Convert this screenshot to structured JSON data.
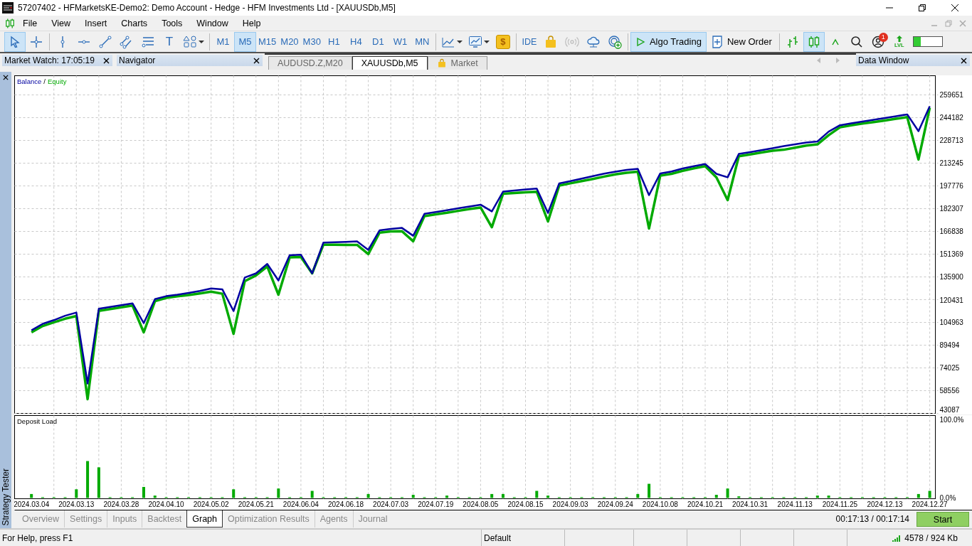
{
  "window": {
    "title": "57207402 - HFMarketsKE-Demo2: Demo Account - Hedge - HFM Investments Ltd - [XAUUSDb,M5]"
  },
  "menu": [
    "File",
    "View",
    "Insert",
    "Charts",
    "Tools",
    "Window",
    "Help"
  ],
  "toolbar": {
    "tools": [
      {
        "kind": "cursor",
        "selected": true
      },
      {
        "kind": "crosshair",
        "selected": false
      },
      {
        "kind": "vline",
        "selected": false
      },
      {
        "kind": "hline",
        "selected": false
      },
      {
        "kind": "trendline",
        "selected": false
      },
      {
        "kind": "channel",
        "selected": false
      },
      {
        "kind": "fibo",
        "selected": false
      },
      {
        "kind": "text",
        "label": "T",
        "selected": false
      },
      {
        "kind": "shapes",
        "selected": false
      }
    ],
    "timeframes": [
      {
        "label": "M1",
        "selected": false
      },
      {
        "label": "M5",
        "selected": true
      },
      {
        "label": "M15",
        "selected": false
      },
      {
        "label": "M20",
        "selected": false
      },
      {
        "label": "M30",
        "selected": false
      },
      {
        "label": "H1",
        "selected": false
      },
      {
        "label": "H4",
        "selected": false
      },
      {
        "label": "D1",
        "selected": false
      },
      {
        "label": "W1",
        "selected": false
      },
      {
        "label": "MN",
        "selected": false
      }
    ],
    "charts": [
      {
        "kind": "line-chart"
      },
      {
        "kind": "template"
      },
      {
        "kind": "dollar",
        "label": "$"
      }
    ],
    "services": [
      {
        "kind": "ide",
        "label": "IDE",
        "disabled": false
      },
      {
        "kind": "bag",
        "disabled": false
      },
      {
        "kind": "signals",
        "disabled": true
      },
      {
        "kind": "cloud",
        "disabled": false
      },
      {
        "kind": "vps",
        "disabled": false
      }
    ],
    "algo_trading": {
      "label": "Algo Trading",
      "on": true
    },
    "new_order": {
      "label": "New Order"
    },
    "chart_types": [
      {
        "kind": "bars",
        "selected": false
      },
      {
        "kind": "candles",
        "selected": true
      },
      {
        "kind": "line",
        "selected": false
      }
    ],
    "account_badge": "1",
    "level_label": "LVL",
    "meter": {
      "level": 0.25
    }
  },
  "panels": [
    {
      "title": "Market Watch: 17:05:19"
    },
    {
      "title": "Navigator"
    }
  ],
  "chart_tabs": [
    {
      "label": "AUDUSD.Z,M20",
      "kind": "chart",
      "selected": false
    },
    {
      "label": "XAUUSDb,M5",
      "kind": "chart",
      "selected": true
    },
    {
      "label": "Market",
      "kind": "market",
      "selected": false
    }
  ],
  "data_window": {
    "title": "Data Window"
  },
  "tester": {
    "title": "Strategy Tester",
    "balance_chart": {
      "legend_separator": "/",
      "chart_data": {
        "type": "line",
        "grid": true,
        "ylim": [
          43087,
          272702
        ],
        "yticks": [
          43087,
          58556,
          74025,
          89494,
          104963,
          120431,
          135900,
          151369,
          166838,
          182307,
          197776,
          213245,
          228713,
          244182,
          259651
        ],
        "categories": [
          null,
          null,
          null,
          null,
          null,
          null,
          null,
          null,
          null,
          null,
          null,
          null,
          null,
          null,
          null,
          null,
          null,
          null,
          null,
          null,
          null,
          null,
          null,
          null,
          null,
          null,
          null,
          null,
          null,
          null,
          null,
          null,
          null,
          null,
          null,
          null,
          null,
          null,
          null,
          null,
          null,
          null,
          null,
          null,
          null,
          null,
          null,
          null,
          null,
          null,
          null,
          null,
          null,
          null,
          null,
          null,
          null,
          null,
          null,
          null,
          null,
          null,
          null,
          null,
          null,
          null,
          null,
          null,
          null,
          null,
          null,
          null,
          null,
          null,
          null,
          null,
          null,
          null,
          null,
          null,
          null,
          null
        ],
        "series": [
          {
            "name": "Balance",
            "color": "#0000a0",
            "values": [
              null,
              99600,
              104000,
              106500,
              109500,
              111700,
              63400,
              114300,
              115500,
              116700,
              117900,
              104500,
              120800,
              122800,
              123800,
              125000,
              126400,
              128000,
              127500,
              112700,
              135500,
              138300,
              144700,
              133500,
              150600,
              151000,
              138300,
              159200,
              159500,
              159700,
              160000,
              154300,
              167500,
              168500,
              169200,
              163900,
              178800,
              180000,
              181200,
              182500,
              183700,
              185000,
              180400,
              193900,
              194600,
              195300,
              196000,
              179400,
              199500,
              201000,
              202700,
              204400,
              206100,
              207500,
              208700,
              209400,
              191500,
              206300,
              207600,
              209600,
              211200,
              212600,
              206000,
              203600,
              219500,
              220800,
              222100,
              223400,
              224800,
              226000,
              227200,
              228000,
              234700,
              239000,
              240300,
              241500,
              242800,
              244000,
              245200,
              246400,
              235000,
              251900
            ]
          },
          {
            "name": "Equity",
            "color": "#00aa00",
            "values": [
              null,
              98200,
              102500,
              105000,
              107500,
              109300,
              52800,
              112800,
              114000,
              115200,
              116400,
              98200,
              119400,
              121600,
              122700,
              123600,
              124700,
              125900,
              124500,
              97200,
              133000,
              136900,
              143000,
              123800,
              149200,
              149400,
              138300,
              157800,
              157800,
              157700,
              157700,
              151400,
              166000,
              166800,
              167000,
              160100,
              177300,
              178400,
              179500,
              180800,
              182000,
              183100,
              169700,
              192500,
              193000,
              193400,
              193800,
              173600,
              198000,
              199500,
              201000,
              202500,
              204100,
              205600,
              206700,
              207400,
              168800,
              204800,
              206000,
              208000,
              209700,
              211200,
              203600,
              188100,
              218000,
              219200,
              220500,
              221700,
              222400,
              223800,
              225200,
              226000,
              232300,
              237600,
              239000,
              240200,
              241200,
              242300,
              243400,
              244500,
              215700,
              250900
            ]
          }
        ]
      }
    },
    "deposit_chart": {
      "chart_data": {
        "type": "bar",
        "grid": true,
        "ylim": [
          -1,
          105
        ],
        "yticks": [
          {
            "value": 0,
            "label": "0.0%"
          },
          {
            "value": 100,
            "label": "100.0%"
          }
        ],
        "categories": [
          null,
          "2024.03.04",
          null,
          null,
          null,
          "2024.03.13",
          null,
          null,
          null,
          "2024.03.28",
          null,
          null,
          null,
          "2024.04.10",
          null,
          null,
          null,
          "2024.05.02",
          null,
          null,
          null,
          "2024.05.21",
          null,
          null,
          null,
          "2024.06.04",
          null,
          null,
          null,
          "2024.06.18",
          null,
          null,
          null,
          "2024.07.03",
          null,
          null,
          null,
          "2024.07.19",
          null,
          null,
          null,
          "2024.08.05",
          null,
          null,
          null,
          "2024.08.15",
          null,
          null,
          null,
          "2024.09.03",
          null,
          null,
          null,
          "2024.09.24",
          null,
          null,
          null,
          "2024.10.08",
          null,
          null,
          null,
          "2024.10.21",
          null,
          null,
          null,
          "2024.10.31",
          null,
          null,
          null,
          "2024.11.13",
          null,
          null,
          null,
          "2024.11.25",
          null,
          null,
          null,
          "2024.12.13",
          null,
          null,
          null,
          "2024.12.27"
        ],
        "series": [
          {
            "name": "Deposit Load",
            "color": "#00aa00",
            "values": [
              null,
              5,
              1,
              1,
              1,
              11,
              47,
              39,
              1,
              1,
              1,
              14,
              3,
              1,
              1,
              1,
              1,
              1,
              1,
              11,
              1,
              1,
              1,
              12,
              1,
              1,
              9,
              1,
              1,
              1,
              1,
              5,
              1,
              1,
              1,
              4,
              1,
              1,
              3,
              1,
              1,
              1,
              5,
              5,
              1,
              1,
              9,
              3,
              1,
              1,
              1,
              1,
              1,
              1,
              1,
              5,
              18,
              1,
              1,
              1,
              1,
              1,
              4,
              12,
              2,
              1,
              1,
              1,
              1,
              1,
              1,
              3,
              3,
              1,
              1,
              1,
              1,
              1,
              1,
              1,
              5,
              9
            ]
          }
        ]
      }
    },
    "tabs": [
      {
        "label": "Overview",
        "selected": false
      },
      {
        "label": "Settings",
        "selected": false
      },
      {
        "label": "Inputs",
        "selected": false
      },
      {
        "label": "Backtest",
        "selected": false
      },
      {
        "label": "Graph",
        "selected": true
      },
      {
        "label": "Optimization Results",
        "selected": false
      },
      {
        "label": "Agents",
        "selected": false
      },
      {
        "label": "Journal",
        "selected": false
      }
    ],
    "elapsed": "00:17:13 / 00:17:14",
    "start_button": "Start"
  },
  "status_bar": {
    "help": "For Help, press F1",
    "profile": "Default",
    "traffic": "4578 / 924 Kb"
  }
}
